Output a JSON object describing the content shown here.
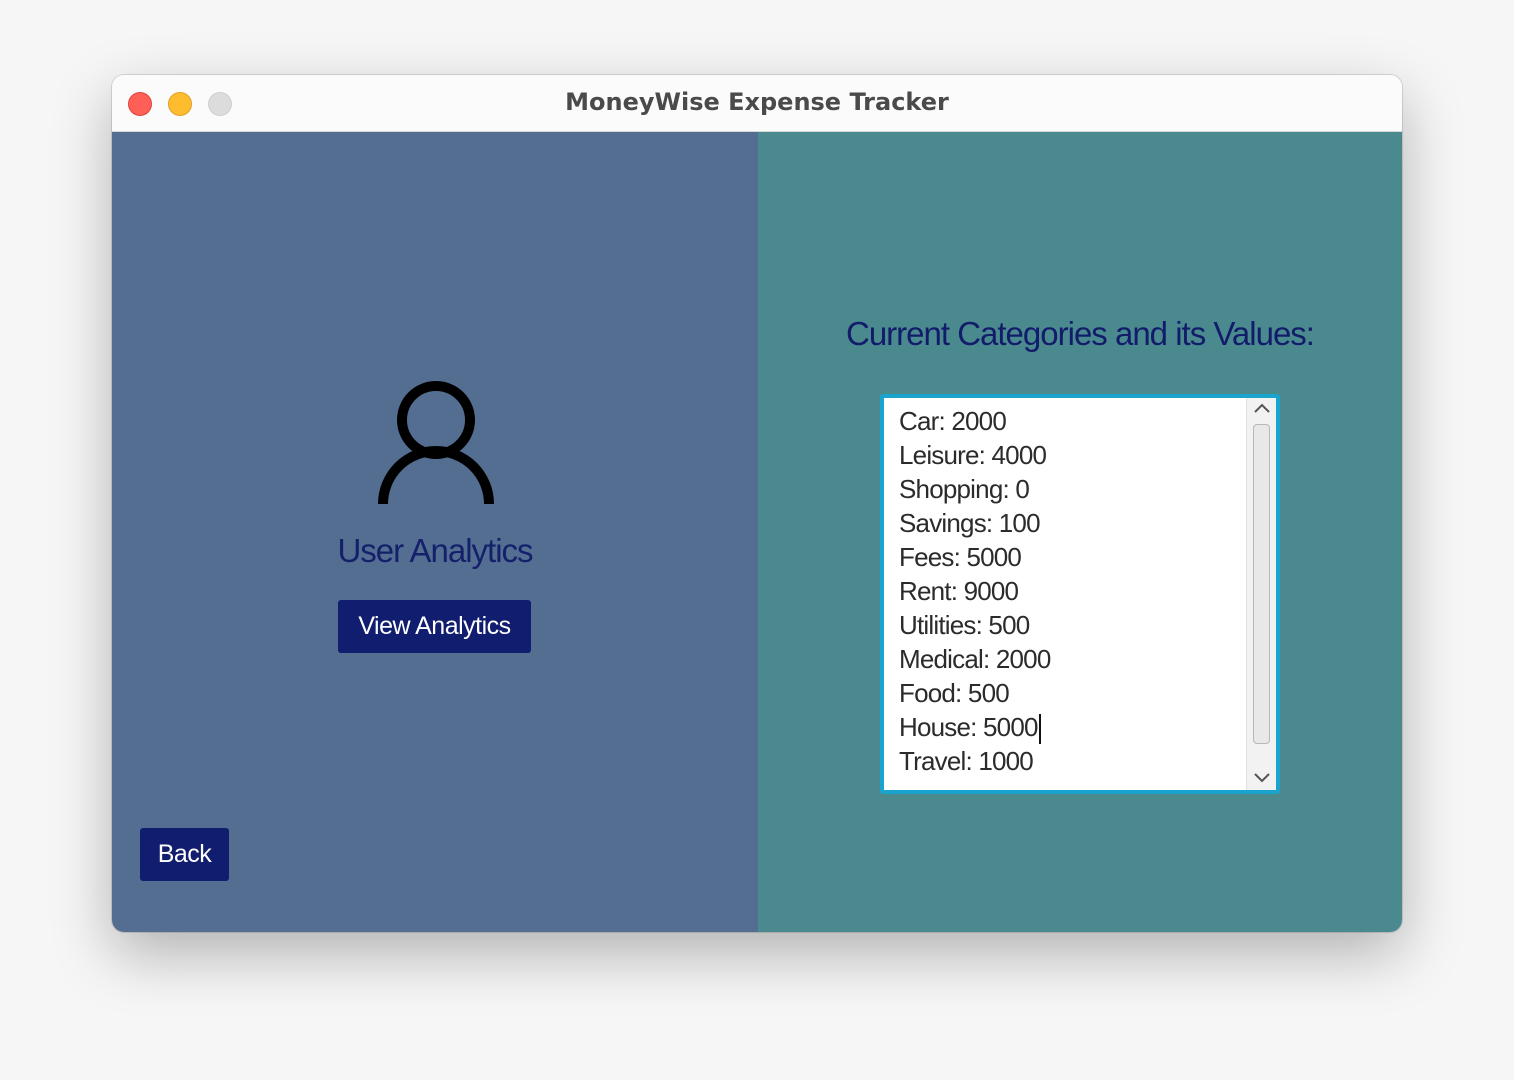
{
  "window": {
    "title": "MoneyWise Expense Tracker"
  },
  "left_panel": {
    "icon": "user-icon",
    "heading": "User Analytics",
    "view_analytics_label": "View Analytics",
    "back_label": "Back"
  },
  "right_panel": {
    "heading": "Current Categories and its Values:",
    "categories": [
      "Car: 2000",
      "Leisure: 4000",
      "Shopping: 0",
      "Savings: 100",
      "Fees: 5000",
      "Rent: 9000",
      "Utilities: 500",
      "Medical: 2000",
      "Food: 500",
      "House: 5000",
      "Travel: 1000"
    ]
  },
  "colors": {
    "left_panel_bg": "#546e91",
    "right_panel_bg": "#4a8a8f",
    "button_bg": "#111d6e",
    "heading_text": "#15206b",
    "listbox_border": "#1aa3cc"
  }
}
